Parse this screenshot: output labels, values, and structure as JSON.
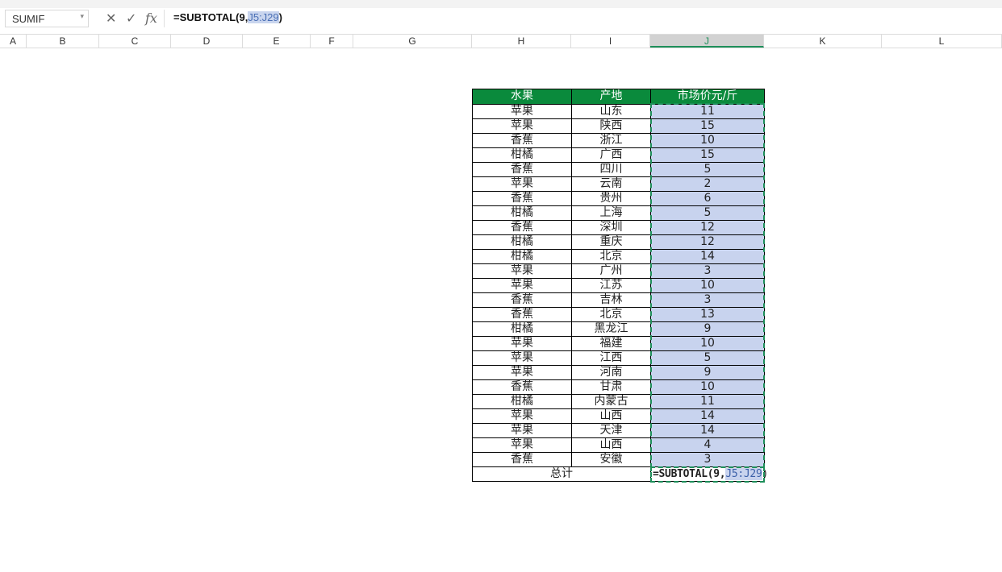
{
  "formula_bar": {
    "name_box": "SUMIF",
    "formula_prefix": "=SUBTOTAL(9,",
    "formula_ref": "J5:J29",
    "formula_suffix": ")",
    "fx_label": "fx"
  },
  "columns": [
    "A",
    "B",
    "C",
    "D",
    "E",
    "F",
    "G",
    "H",
    "I",
    "J",
    "K",
    "L"
  ],
  "table": {
    "headers": [
      "水果",
      "产地",
      "市场价元/斤"
    ],
    "rows": [
      [
        "苹果",
        "山东",
        "11"
      ],
      [
        "苹果",
        "陕西",
        "15"
      ],
      [
        "香蕉",
        "浙江",
        "10"
      ],
      [
        "柑橘",
        "广西",
        "15"
      ],
      [
        "香蕉",
        "四川",
        "5"
      ],
      [
        "苹果",
        "云南",
        "2"
      ],
      [
        "香蕉",
        "贵州",
        "6"
      ],
      [
        "柑橘",
        "上海",
        "5"
      ],
      [
        "香蕉",
        "深圳",
        "12"
      ],
      [
        "柑橘",
        "重庆",
        "12"
      ],
      [
        "柑橘",
        "北京",
        "14"
      ],
      [
        "苹果",
        "广州",
        "3"
      ],
      [
        "苹果",
        "江苏",
        "10"
      ],
      [
        "香蕉",
        "吉林",
        "3"
      ],
      [
        "香蕉",
        "北京",
        "13"
      ],
      [
        "柑橘",
        "黑龙江",
        "9"
      ],
      [
        "苹果",
        "福建",
        "10"
      ],
      [
        "苹果",
        "江西",
        "5"
      ],
      [
        "苹果",
        "河南",
        "9"
      ],
      [
        "香蕉",
        "甘肃",
        "10"
      ],
      [
        "柑橘",
        "内蒙古",
        "11"
      ],
      [
        "苹果",
        "山西",
        "14"
      ],
      [
        "苹果",
        "天津",
        "14"
      ],
      [
        "苹果",
        "山西",
        "4"
      ],
      [
        "香蕉",
        "安徽",
        "3"
      ]
    ],
    "total_label": "总计",
    "total_formula_prefix": "=SUBTOTAL(9,",
    "total_formula_ref": "J5:J29",
    "total_formula_suffix": ")"
  },
  "colors": {
    "header_green": "#0a8a3c",
    "selection_blue": "#c8d3ee",
    "marquee_green": "#1e8f5a"
  }
}
